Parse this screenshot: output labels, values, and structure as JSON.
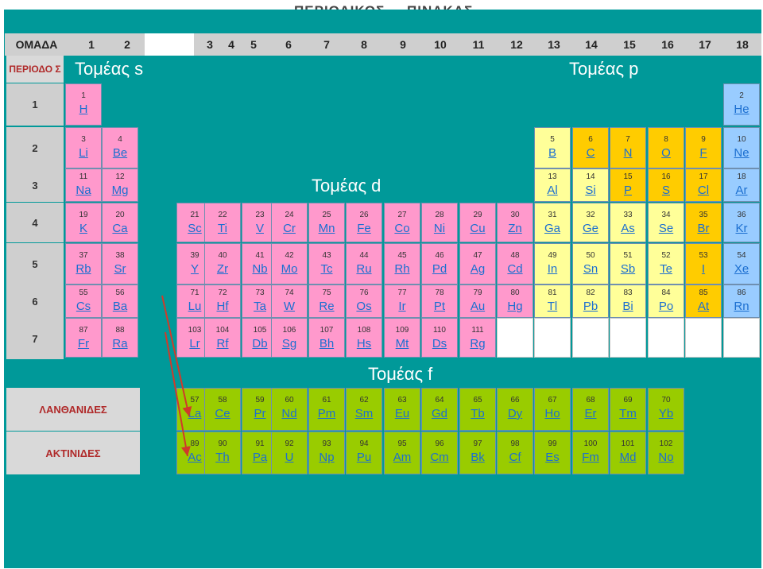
{
  "title": {
    "part1": "ΠΕΡΙΟΔΙΚΟΣ",
    "part2": "ΠΙΝΑΚΑΣ"
  },
  "header": {
    "group_label": "ΟΜΑΔΑ",
    "groups": [
      "1",
      "2",
      "3",
      "4",
      "5",
      "6",
      "7",
      "8",
      "9",
      "10",
      "11",
      "12",
      "13",
      "14",
      "15",
      "16",
      "17",
      "18"
    ]
  },
  "period_label": "ΠΕΡΙΟΔΟ Σ",
  "periods": [
    "1",
    "2",
    "3",
    "4",
    "5",
    "6",
    "7"
  ],
  "sectors": {
    "s": "Τομέας s",
    "p": "Τομέας p",
    "d": "Τομέας d",
    "f": "Τομέας f"
  },
  "rows": {
    "lanthanides": "ΛΑΝΘΑΝΙΔΕΣ",
    "actinides": "ΑΚΤΙΝΙΔΕΣ"
  },
  "colors": {
    "background": "#009999",
    "s_block": "#ff99cc",
    "d_block": "#ff99cc",
    "metalloid": "#ffff99",
    "nonmetal": "#ffcc00",
    "noble_gas": "#99ccff",
    "f_block": "#99cc00",
    "arrow": "#d03a2a"
  },
  "elements": [
    {
      "n": "1",
      "s": "H",
      "p": 1,
      "g": 1,
      "c": "s"
    },
    {
      "n": "2",
      "s": "He",
      "p": 1,
      "g": 18,
      "c": "ng"
    },
    {
      "n": "3",
      "s": "Li",
      "p": 2,
      "g": 1,
      "c": "s"
    },
    {
      "n": "4",
      "s": "Be",
      "p": 2,
      "g": 2,
      "c": "s"
    },
    {
      "n": "5",
      "s": "B",
      "p": 2,
      "g": 13,
      "c": "pm"
    },
    {
      "n": "6",
      "s": "C",
      "p": 2,
      "g": 14,
      "c": "pn"
    },
    {
      "n": "7",
      "s": "N",
      "p": 2,
      "g": 15,
      "c": "pn"
    },
    {
      "n": "8",
      "s": "O",
      "p": 2,
      "g": 16,
      "c": "pn"
    },
    {
      "n": "9",
      "s": "F",
      "p": 2,
      "g": 17,
      "c": "pn"
    },
    {
      "n": "10",
      "s": "Ne",
      "p": 2,
      "g": 18,
      "c": "ng"
    },
    {
      "n": "11",
      "s": "Na",
      "p": 3,
      "g": 1,
      "c": "s"
    },
    {
      "n": "12",
      "s": "Mg",
      "p": 3,
      "g": 2,
      "c": "s"
    },
    {
      "n": "13",
      "s": "Al",
      "p": 3,
      "g": 13,
      "c": "pm"
    },
    {
      "n": "14",
      "s": "Si",
      "p": 3,
      "g": 14,
      "c": "pm"
    },
    {
      "n": "15",
      "s": "P",
      "p": 3,
      "g": 15,
      "c": "pn"
    },
    {
      "n": "16",
      "s": "S",
      "p": 3,
      "g": 16,
      "c": "pn"
    },
    {
      "n": "17",
      "s": "Cl",
      "p": 3,
      "g": 17,
      "c": "pn"
    },
    {
      "n": "18",
      "s": "Ar",
      "p": 3,
      "g": 18,
      "c": "ng"
    },
    {
      "n": "19",
      "s": "K",
      "p": 4,
      "g": 1,
      "c": "s"
    },
    {
      "n": "20",
      "s": "Ca",
      "p": 4,
      "g": 2,
      "c": "s"
    },
    {
      "n": "21",
      "s": "Sc",
      "p": 4,
      "g": 3,
      "c": "d"
    },
    {
      "n": "22",
      "s": "Ti",
      "p": 4,
      "g": 4,
      "c": "d"
    },
    {
      "n": "23",
      "s": "V",
      "p": 4,
      "g": 5,
      "c": "d"
    },
    {
      "n": "24",
      "s": "Cr",
      "p": 4,
      "g": 6,
      "c": "d"
    },
    {
      "n": "25",
      "s": "Mn",
      "p": 4,
      "g": 7,
      "c": "d"
    },
    {
      "n": "26",
      "s": "Fe",
      "p": 4,
      "g": 8,
      "c": "d"
    },
    {
      "n": "27",
      "s": "Co",
      "p": 4,
      "g": 9,
      "c": "d"
    },
    {
      "n": "28",
      "s": "Ni",
      "p": 4,
      "g": 10,
      "c": "d"
    },
    {
      "n": "29",
      "s": "Cu",
      "p": 4,
      "g": 11,
      "c": "d"
    },
    {
      "n": "30",
      "s": "Zn",
      "p": 4,
      "g": 12,
      "c": "d"
    },
    {
      "n": "31",
      "s": "Ga",
      "p": 4,
      "g": 13,
      "c": "pm"
    },
    {
      "n": "32",
      "s": "Ge",
      "p": 4,
      "g": 14,
      "c": "pm"
    },
    {
      "n": "33",
      "s": "As",
      "p": 4,
      "g": 15,
      "c": "pm"
    },
    {
      "n": "34",
      "s": "Se",
      "p": 4,
      "g": 16,
      "c": "pm"
    },
    {
      "n": "35",
      "s": "Br",
      "p": 4,
      "g": 17,
      "c": "pn"
    },
    {
      "n": "36",
      "s": "Kr",
      "p": 4,
      "g": 18,
      "c": "ng"
    },
    {
      "n": "37",
      "s": "Rb",
      "p": 5,
      "g": 1,
      "c": "s"
    },
    {
      "n": "38",
      "s": "Sr",
      "p": 5,
      "g": 2,
      "c": "s"
    },
    {
      "n": "39",
      "s": "Y",
      "p": 5,
      "g": 3,
      "c": "d"
    },
    {
      "n": "40",
      "s": "Zr",
      "p": 5,
      "g": 4,
      "c": "d"
    },
    {
      "n": "41",
      "s": "Nb",
      "p": 5,
      "g": 5,
      "c": "d"
    },
    {
      "n": "42",
      "s": "Mo",
      "p": 5,
      "g": 6,
      "c": "d"
    },
    {
      "n": "43",
      "s": "Tc",
      "p": 5,
      "g": 7,
      "c": "d"
    },
    {
      "n": "44",
      "s": "Ru",
      "p": 5,
      "g": 8,
      "c": "d"
    },
    {
      "n": "45",
      "s": "Rh",
      "p": 5,
      "g": 9,
      "c": "d"
    },
    {
      "n": "46",
      "s": "Pd",
      "p": 5,
      "g": 10,
      "c": "d"
    },
    {
      "n": "47",
      "s": "Ag",
      "p": 5,
      "g": 11,
      "c": "d"
    },
    {
      "n": "48",
      "s": "Cd",
      "p": 5,
      "g": 12,
      "c": "d"
    },
    {
      "n": "49",
      "s": "In",
      "p": 5,
      "g": 13,
      "c": "pm"
    },
    {
      "n": "50",
      "s": "Sn",
      "p": 5,
      "g": 14,
      "c": "pm"
    },
    {
      "n": "51",
      "s": "Sb",
      "p": 5,
      "g": 15,
      "c": "pm"
    },
    {
      "n": "52",
      "s": "Te",
      "p": 5,
      "g": 16,
      "c": "pm"
    },
    {
      "n": "53",
      "s": "I",
      "p": 5,
      "g": 17,
      "c": "pn"
    },
    {
      "n": "54",
      "s": "Xe",
      "p": 5,
      "g": 18,
      "c": "ng"
    },
    {
      "n": "55",
      "s": "Cs",
      "p": 6,
      "g": 1,
      "c": "s"
    },
    {
      "n": "56",
      "s": "Ba",
      "p": 6,
      "g": 2,
      "c": "s"
    },
    {
      "n": "71",
      "s": "Lu",
      "p": 6,
      "g": 3,
      "c": "d"
    },
    {
      "n": "72",
      "s": "Hf",
      "p": 6,
      "g": 4,
      "c": "d"
    },
    {
      "n": "73",
      "s": "Ta",
      "p": 6,
      "g": 5,
      "c": "d"
    },
    {
      "n": "74",
      "s": "W",
      "p": 6,
      "g": 6,
      "c": "d"
    },
    {
      "n": "75",
      "s": "Re",
      "p": 6,
      "g": 7,
      "c": "d"
    },
    {
      "n": "76",
      "s": "Os",
      "p": 6,
      "g": 8,
      "c": "d"
    },
    {
      "n": "77",
      "s": "Ir",
      "p": 6,
      "g": 9,
      "c": "d"
    },
    {
      "n": "78",
      "s": "Pt",
      "p": 6,
      "g": 10,
      "c": "d"
    },
    {
      "n": "79",
      "s": "Au",
      "p": 6,
      "g": 11,
      "c": "d"
    },
    {
      "n": "80",
      "s": "Hg",
      "p": 6,
      "g": 12,
      "c": "d"
    },
    {
      "n": "81",
      "s": "Tl",
      "p": 6,
      "g": 13,
      "c": "pm"
    },
    {
      "n": "82",
      "s": "Pb",
      "p": 6,
      "g": 14,
      "c": "pm"
    },
    {
      "n": "83",
      "s": "Bi",
      "p": 6,
      "g": 15,
      "c": "pm"
    },
    {
      "n": "84",
      "s": "Po",
      "p": 6,
      "g": 16,
      "c": "pm"
    },
    {
      "n": "85",
      "s": "At",
      "p": 6,
      "g": 17,
      "c": "pn"
    },
    {
      "n": "86",
      "s": "Rn",
      "p": 6,
      "g": 18,
      "c": "ng"
    },
    {
      "n": "87",
      "s": "Fr",
      "p": 7,
      "g": 1,
      "c": "s"
    },
    {
      "n": "88",
      "s": "Ra",
      "p": 7,
      "g": 2,
      "c": "s"
    },
    {
      "n": "103",
      "s": "Lr",
      "p": 7,
      "g": 3,
      "c": "d"
    },
    {
      "n": "104",
      "s": "Rf",
      "p": 7,
      "g": 4,
      "c": "d"
    },
    {
      "n": "105",
      "s": "Db",
      "p": 7,
      "g": 5,
      "c": "d"
    },
    {
      "n": "106",
      "s": "Sg",
      "p": 7,
      "g": 6,
      "c": "d"
    },
    {
      "n": "107",
      "s": "Bh",
      "p": 7,
      "g": 7,
      "c": "d"
    },
    {
      "n": "108",
      "s": "Hs",
      "p": 7,
      "g": 8,
      "c": "d"
    },
    {
      "n": "109",
      "s": "Mt",
      "p": 7,
      "g": 9,
      "c": "d"
    },
    {
      "n": "110",
      "s": "Ds",
      "p": 7,
      "g": 10,
      "c": "d"
    },
    {
      "n": "111",
      "s": "Rg",
      "p": 7,
      "g": 11,
      "c": "d"
    }
  ],
  "lanthanides": [
    {
      "n": "57",
      "s": "La"
    },
    {
      "n": "58",
      "s": "Ce"
    },
    {
      "n": "59",
      "s": "Pr"
    },
    {
      "n": "60",
      "s": "Nd"
    },
    {
      "n": "61",
      "s": "Pm"
    },
    {
      "n": "62",
      "s": "Sm"
    },
    {
      "n": "63",
      "s": "Eu"
    },
    {
      "n": "64",
      "s": "Gd"
    },
    {
      "n": "65",
      "s": "Tb"
    },
    {
      "n": "66",
      "s": "Dy"
    },
    {
      "n": "67",
      "s": "Ho"
    },
    {
      "n": "68",
      "s": "Er"
    },
    {
      "n": "69",
      "s": "Tm"
    },
    {
      "n": "70",
      "s": "Yb"
    }
  ],
  "actinides": [
    {
      "n": "89",
      "s": "Ac"
    },
    {
      "n": "90",
      "s": "Th"
    },
    {
      "n": "91",
      "s": "Pa"
    },
    {
      "n": "92",
      "s": "U"
    },
    {
      "n": "93",
      "s": "Np"
    },
    {
      "n": "94",
      "s": "Pu"
    },
    {
      "n": "95",
      "s": "Am"
    },
    {
      "n": "96",
      "s": "Cm"
    },
    {
      "n": "97",
      "s": "Bk"
    },
    {
      "n": "98",
      "s": "Cf"
    },
    {
      "n": "99",
      "s": "Es"
    },
    {
      "n": "100",
      "s": "Fm"
    },
    {
      "n": "101",
      "s": "Md"
    },
    {
      "n": "102",
      "s": "No"
    }
  ]
}
